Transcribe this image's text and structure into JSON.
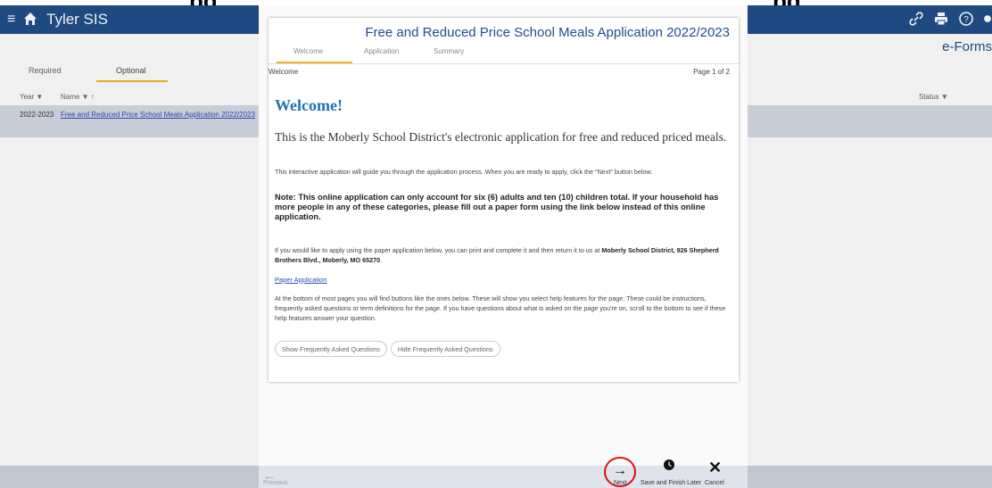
{
  "caption": {
    "left": "pg,",
    "right": "pg"
  },
  "app": {
    "brand": "Tyler SIS",
    "page_title": "e-Forms",
    "tabs": [
      {
        "label": "Required"
      },
      {
        "label": "Optional"
      }
    ],
    "list": {
      "columns": {
        "year": "Year",
        "name": "Name",
        "status": "Status"
      },
      "rows": [
        {
          "year": "2022-2023",
          "name": "Free and Reduced Price School Meals Application 2022/2023"
        }
      ]
    }
  },
  "form": {
    "title": "Free and Reduced Price School Meals Application 2022/2023",
    "steps": [
      {
        "label": "Welcome"
      },
      {
        "label": "Application"
      },
      {
        "label": "Summary"
      }
    ],
    "current_step": "Welcome",
    "page_indicator": "Page 1 of 2",
    "heading": "Welcome!",
    "intro": "This is the Moberly School District's electronic application for free and reduced priced meals.",
    "p1": "This interactive application will guide you through the application process. When you are ready to apply, click the \"Next\" button below.",
    "note": "Note: This online application can only account for six (6) adults and ten (10) children total. If your household has more people in any of these categories, please fill out a paper form using the link below instead of this online application.",
    "p2_text": "If you would like to apply using the paper application below, you can print and complete it and then return it to us at ",
    "p2_address": "Moberly School District, 926 Shepherd Brothers Blvd., Moberly, MO 65270",
    "p2_end": ".",
    "paper_link": "Paper Application",
    "p3": "At the bottom of most pages you will find buttons like the ones below. These will show you select help features for the page. These could be instructions, frequently asked questions or term definitions for the page. If you have questions about what is asked on the page you're on, scroll to the bottom to see if these help features answer your question.",
    "show_faq": "Show Frequently Asked Questions",
    "hide_faq": "Hide Frequently Asked Questions"
  },
  "footer": {
    "previous": "Previous",
    "next": "Next",
    "save": "Save and Finish Later",
    "cancel": "Cancel"
  },
  "colors": {
    "header": "#214e8a",
    "accent": "#f0b429",
    "heading": "#1f74b5",
    "highlight": "#dd1111"
  },
  "icons": [
    "menu-icon",
    "home-icon",
    "link-icon",
    "print-icon",
    "help-icon",
    "filter-icon",
    "sort-up-icon",
    "arrow-left-icon",
    "arrow-right-icon",
    "clock-icon",
    "close-icon"
  ]
}
